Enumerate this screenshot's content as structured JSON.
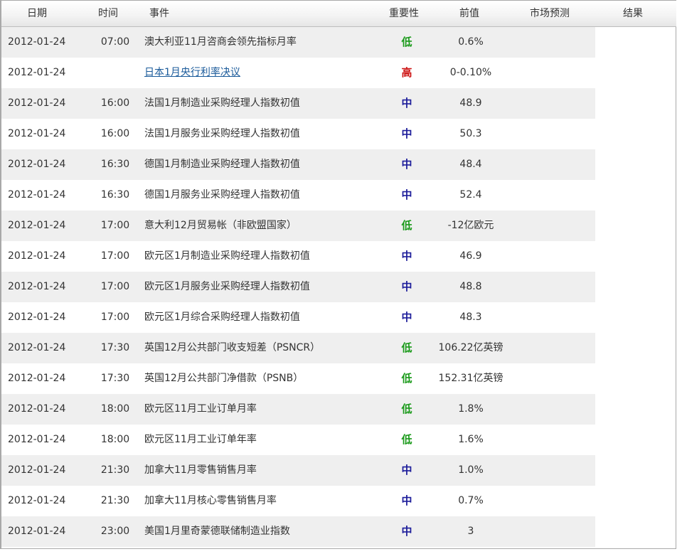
{
  "header": {
    "date": "日期",
    "time": "时间",
    "event": "事件",
    "importance": "重要性",
    "previous": "前值",
    "forecast": "市场预测",
    "result": "结果"
  },
  "colors": {
    "low": "#1a9a1a",
    "mid": "#1c1c9a",
    "high": "#cc1010",
    "link": "#1a5a9a",
    "row_alt": "#efefef"
  },
  "rows": [
    {
      "date": "2012-01-24",
      "time": "07:00",
      "event": "澳大利亚11月咨商会领先指标月率",
      "importance": "低",
      "level": "low",
      "previous": "0.6%",
      "link": false
    },
    {
      "date": "2012-01-24",
      "time": "",
      "event": "日本1月央行利率决议",
      "importance": "高",
      "level": "high",
      "previous": "0-0.10%",
      "link": true
    },
    {
      "date": "2012-01-24",
      "time": "16:00",
      "event": "法国1月制造业采购经理人指数初值",
      "importance": "中",
      "level": "mid",
      "previous": "48.9",
      "link": false
    },
    {
      "date": "2012-01-24",
      "time": "16:00",
      "event": "法国1月服务业采购经理人指数初值",
      "importance": "中",
      "level": "mid",
      "previous": "50.3",
      "link": false
    },
    {
      "date": "2012-01-24",
      "time": "16:30",
      "event": "德国1月制造业采购经理人指数初值",
      "importance": "中",
      "level": "mid",
      "previous": "48.4",
      "link": false
    },
    {
      "date": "2012-01-24",
      "time": "16:30",
      "event": "德国1月服务业采购经理人指数初值",
      "importance": "中",
      "level": "mid",
      "previous": "52.4",
      "link": false
    },
    {
      "date": "2012-01-24",
      "time": "17:00",
      "event": "意大利12月贸易帐（非欧盟国家）",
      "importance": "低",
      "level": "low",
      "previous": "-12亿欧元",
      "link": false
    },
    {
      "date": "2012-01-24",
      "time": "17:00",
      "event": "欧元区1月制造业采购经理人指数初值",
      "importance": "中",
      "level": "mid",
      "previous": "46.9",
      "link": false
    },
    {
      "date": "2012-01-24",
      "time": "17:00",
      "event": "欧元区1月服务业采购经理人指数初值",
      "importance": "中",
      "level": "mid",
      "previous": "48.8",
      "link": false
    },
    {
      "date": "2012-01-24",
      "time": "17:00",
      "event": "欧元区1月综合采购经理人指数初值",
      "importance": "中",
      "level": "mid",
      "previous": "48.3",
      "link": false
    },
    {
      "date": "2012-01-24",
      "time": "17:30",
      "event": "英国12月公共部门收支短差（PSNCR）",
      "importance": "低",
      "level": "low",
      "previous": "106.22亿英镑",
      "link": false
    },
    {
      "date": "2012-01-24",
      "time": "17:30",
      "event": "英国12月公共部门净借款（PSNB）",
      "importance": "低",
      "level": "low",
      "previous": "152.31亿英镑",
      "link": false
    },
    {
      "date": "2012-01-24",
      "time": "18:00",
      "event": "欧元区11月工业订单月率",
      "importance": "低",
      "level": "low",
      "previous": "1.8%",
      "link": false
    },
    {
      "date": "2012-01-24",
      "time": "18:00",
      "event": "欧元区11月工业订单年率",
      "importance": "低",
      "level": "low",
      "previous": "1.6%",
      "link": false
    },
    {
      "date": "2012-01-24",
      "time": "21:30",
      "event": "加拿大11月零售销售月率",
      "importance": "中",
      "level": "mid",
      "previous": "1.0%",
      "link": false
    },
    {
      "date": "2012-01-24",
      "time": "21:30",
      "event": "加拿大11月核心零售销售月率",
      "importance": "中",
      "level": "mid",
      "previous": "0.7%",
      "link": false
    },
    {
      "date": "2012-01-24",
      "time": "23:00",
      "event": "美国1月里奇蒙德联储制造业指数",
      "importance": "中",
      "level": "mid",
      "previous": "3",
      "link": false
    }
  ]
}
